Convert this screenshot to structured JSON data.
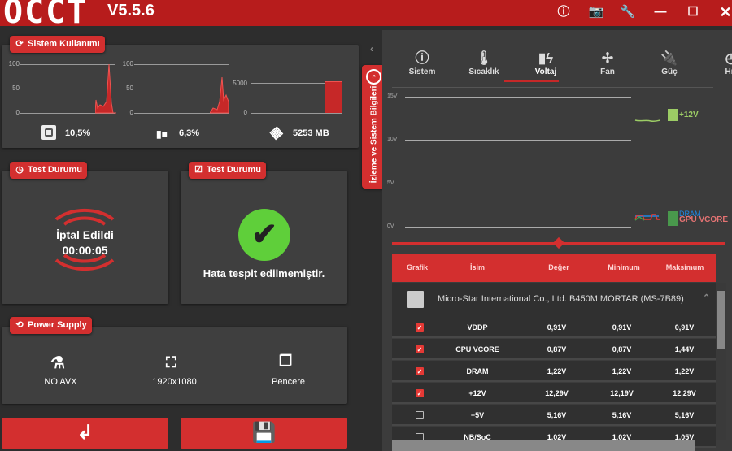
{
  "app": {
    "logo": "OCCT",
    "version": "V5.5.6"
  },
  "titlebar_icons": [
    "info-icon",
    "camera-icon",
    "wrench-icon",
    "minimize-icon",
    "maximize-icon",
    "close-icon"
  ],
  "system_usage": {
    "title": "Sistem Kullanımı",
    "cpu": {
      "axis": [
        "100",
        "50",
        "0"
      ],
      "value": "10,5%"
    },
    "gpu": {
      "axis": [
        "100",
        "50",
        "0"
      ],
      "value": "6,3%"
    },
    "ram": {
      "axis": [
        "5000",
        "0"
      ],
      "value": "5253 MB"
    }
  },
  "test_status": {
    "title": "Test Durumu",
    "state": "İptal Edildi",
    "time": "00:00:05"
  },
  "error_status": {
    "title": "Test Durumu",
    "message": "Hata tespit edilmemiştir."
  },
  "power_supply": {
    "title": "Power Supply",
    "items": [
      "NO AVX",
      "1920x1080",
      "Pencere"
    ]
  },
  "side_tab": "İzleme ve Sistem Bilgileri",
  "tabs": [
    "Sistem",
    "Sıcaklık",
    "Voltaj",
    "Fan",
    "Güç",
    "Hız"
  ],
  "active_tab": "Voltaj",
  "chart_data": {
    "type": "line",
    "yticks": [
      "15V",
      "10V",
      "5V",
      "0V"
    ],
    "ylim": [
      0,
      15
    ],
    "legend": [
      "+12V",
      "DRAM",
      "GPU VCORE"
    ],
    "colors": {
      "+12V": "#9ccc65",
      "DRAM": "#1e88e5",
      "GPU VCORE": "#e53935"
    }
  },
  "table": {
    "headers": [
      "Grafik",
      "İsim",
      "Değer",
      "Minimum",
      "Maksimum"
    ],
    "group": "Micro-Star International Co., Ltd. B450M MORTAR (MS-7B89)",
    "rows": [
      {
        "checked": true,
        "name": "VDDP",
        "value": "0,91V",
        "min": "0,91V",
        "max": "0,91V"
      },
      {
        "checked": true,
        "name": "CPU VCORE",
        "value": "0,87V",
        "min": "0,87V",
        "max": "1,44V"
      },
      {
        "checked": true,
        "name": "DRAM",
        "value": "1,22V",
        "min": "1,22V",
        "max": "1,22V"
      },
      {
        "checked": true,
        "name": "+12V",
        "value": "12,29V",
        "min": "12,19V",
        "max": "12,29V"
      },
      {
        "checked": false,
        "name": "+5V",
        "value": "5,16V",
        "min": "5,16V",
        "max": "5,16V"
      },
      {
        "checked": false,
        "name": "NB/SoC",
        "value": "1,02V",
        "min": "1,02V",
        "max": "1,05V"
      }
    ]
  },
  "colors": {
    "accent": "#d32f2f",
    "titlebar": "#b71c1c",
    "ok": "#4caf50"
  }
}
